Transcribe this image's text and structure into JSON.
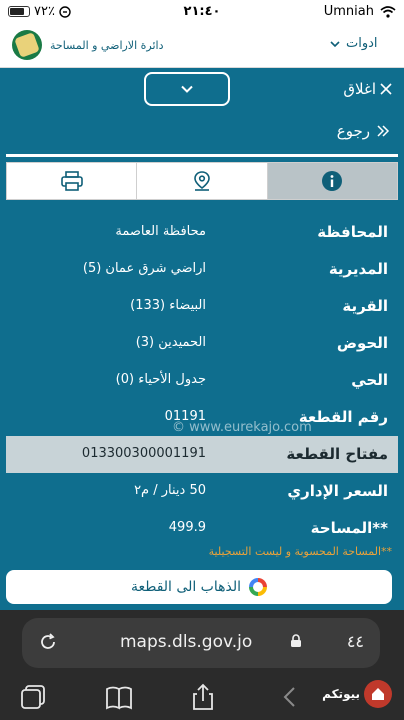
{
  "status_bar": {
    "battery": "٧٢٪",
    "time": "٢١:٤٠",
    "carrier": "Umniah"
  },
  "header": {
    "tools_label": "ادوات",
    "logo_text": "دائرة الاراضي و المساحة"
  },
  "close_label": "اغلاق",
  "back_label": "رجوع",
  "tabs": [
    "info",
    "location",
    "print"
  ],
  "rows": [
    {
      "label": "المحافظة",
      "value": "محافظة العاصمة"
    },
    {
      "label": "المديرية",
      "value": "اراضي شرق عمان (5)"
    },
    {
      "label": "القرية",
      "value": "البيضاء (133)"
    },
    {
      "label": "الحوض",
      "value": "الحميدين (3)"
    },
    {
      "label": "الحي",
      "value": "جدول الأحياء (0)"
    },
    {
      "label": "رقم القطعة",
      "value": "01191"
    },
    {
      "label": "مفتاح القطعة",
      "value": "013300300001191"
    },
    {
      "label": "السعر الإداري",
      "value": "50 دينار / م٢"
    },
    {
      "label": "المساحة**",
      "value": "499.9"
    }
  ],
  "watermark": "© www.eurekajo.com",
  "footnote": "**المساحة المحسوبة و ليست التسجيلية",
  "goto_label": "الذهاب الى القطعة",
  "browser": {
    "url": "maps.dls.gov.jo",
    "text_size": "٤٤",
    "brand": "بيوتكم"
  }
}
